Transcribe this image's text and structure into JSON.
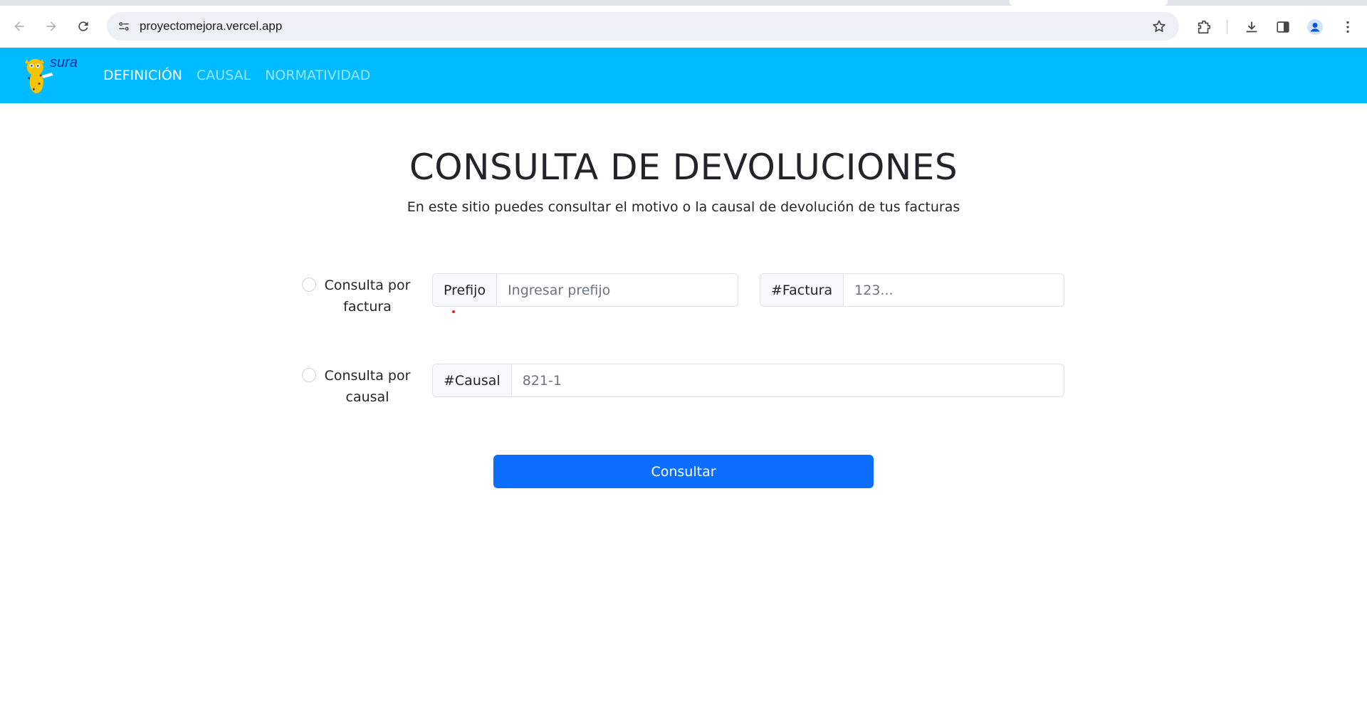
{
  "browser": {
    "url": "proyectomejora.vercel.app"
  },
  "navbar": {
    "brand": "sura",
    "links": [
      {
        "label": "DEFINICIÓN",
        "active": true
      },
      {
        "label": "CAUSAL",
        "active": false
      },
      {
        "label": "NORMATIVIDAD",
        "active": false
      }
    ]
  },
  "main": {
    "title": "CONSULTA DE DEVOLUCIONES",
    "subtitle": "En este sitio puedes consultar el motivo o la causal de devolución de tus facturas"
  },
  "form": {
    "option_factura": {
      "label_line1": "Consulta por",
      "label_line2": "factura"
    },
    "option_causal": {
      "label_line1": "Consulta por",
      "label_line2": "causal"
    },
    "prefijo": {
      "addon": "Prefijo",
      "placeholder": "Ingresar prefijo",
      "value": ""
    },
    "factura": {
      "addon": "#Factura",
      "placeholder": "123...",
      "value": ""
    },
    "causal": {
      "addon": "#Causal",
      "placeholder": "821-1",
      "value": ""
    },
    "submit_label": "Consultar"
  },
  "colors": {
    "navbar": "#00bbff",
    "primary_button": "#0d6efd"
  }
}
